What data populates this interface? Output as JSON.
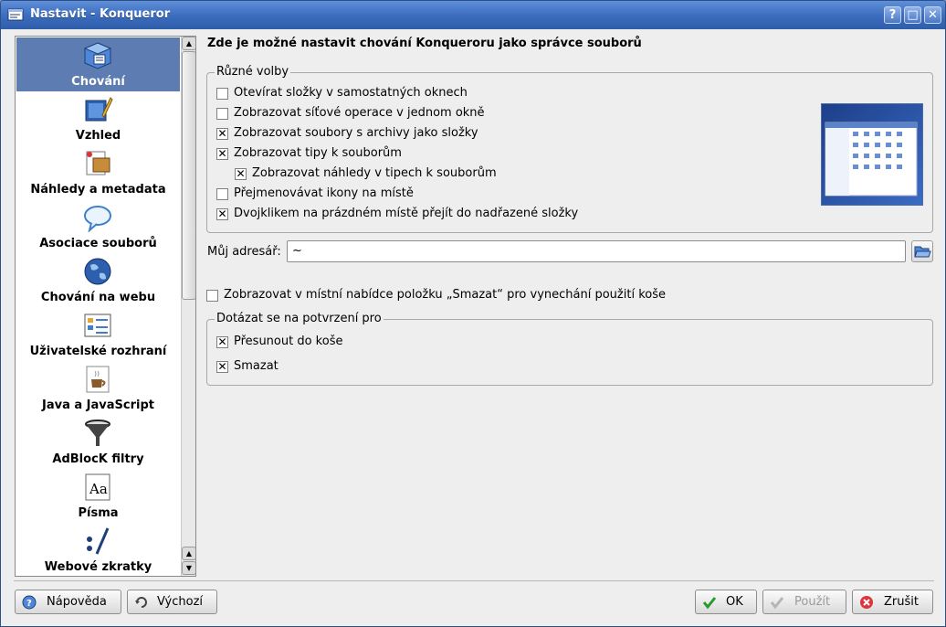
{
  "window": {
    "title": "Nastavit - Konqueror",
    "controls": [
      "?",
      "□",
      "✕"
    ]
  },
  "sidebar": {
    "items": [
      {
        "label": "Chování",
        "icon": "behavior-icon",
        "active": true
      },
      {
        "label": "Vzhled",
        "icon": "appearance-icon"
      },
      {
        "label": "Náhledy a metadata",
        "icon": "previews-icon"
      },
      {
        "label": "Asociace souborů",
        "icon": "file-associations-icon"
      },
      {
        "label": "Chování na webu",
        "icon": "web-behavior-icon"
      },
      {
        "label": "Uživatelské rozhraní",
        "icon": "user-interface-icon"
      },
      {
        "label": "Java a JavaScript",
        "icon": "java-icon"
      },
      {
        "label": "AdBlocK filtry",
        "icon": "adblock-funnel-icon"
      },
      {
        "label": "Písma",
        "icon": "fonts-icon"
      },
      {
        "label": "Webové zkratky",
        "icon": "web-shortcuts-icon"
      }
    ]
  },
  "main": {
    "heading": "Zde je možné nastavit chování Konqueroru jako správce souborů",
    "misc_group": {
      "title": "Různé volby",
      "options": [
        {
          "label": "Otevírat složky v samostatných oknech",
          "checked": false
        },
        {
          "label": "Zobrazovat síťové operace v jednom okně",
          "checked": false
        },
        {
          "label": "Zobrazovat soubory s archivy jako složky",
          "checked": true
        },
        {
          "label": "Zobrazovat tipy k souborům",
          "checked": true
        },
        {
          "label": "Zobrazovat náhledy v tipech k souborům",
          "checked": true
        },
        {
          "label": "Přejmenovávat ikony na místě",
          "checked": false
        },
        {
          "label": "Dvojklikem na prázdném místě přejít do nadřazené složky",
          "checked": true
        }
      ]
    },
    "home_dir": {
      "label": "Můj adresář:",
      "value": "~"
    },
    "delete_option": {
      "label": "Zobrazovat v místní nabídce položku „Smazat“ pro vynechání použití koše",
      "checked": false
    },
    "confirm_group": {
      "title": "Dotázat se na potvrzení pro",
      "options": [
        {
          "label": "Přesunout do koše",
          "checked": true
        },
        {
          "label": "Smazat",
          "checked": true
        }
      ]
    }
  },
  "buttons": {
    "help": "Nápověda",
    "defaults": "Výchozí",
    "ok": "OK",
    "apply": "Použít",
    "cancel": "Zrušit"
  },
  "colors": {
    "title_bar": "#3a6bbd",
    "selection": "#5d7db2",
    "window_bg": "#eeeeee"
  }
}
